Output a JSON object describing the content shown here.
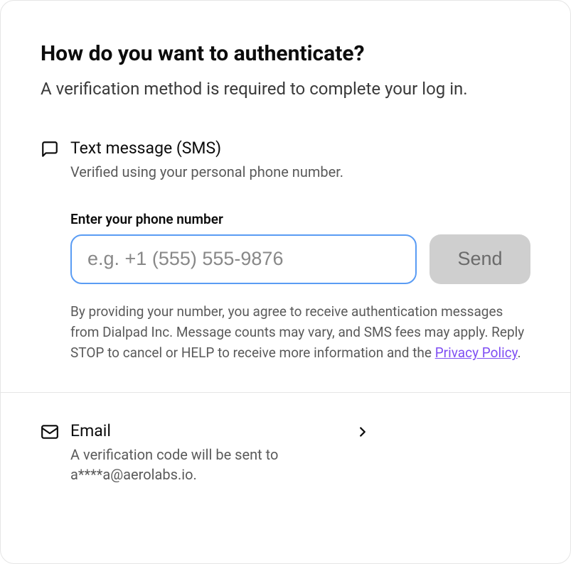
{
  "header": {
    "title": "How do you want to authenticate?",
    "subtitle": "A verification method is required to complete your log in."
  },
  "sms": {
    "title": "Text message (SMS)",
    "description": "Verified using your personal phone number.",
    "input_label": "Enter your phone number",
    "input_placeholder": "e.g. +1 (555) 555-9876",
    "input_value": "",
    "send_label": "Send",
    "disclaimer_prefix": "By providing your number, you agree to receive authentication messages from Dialpad Inc. Message counts may vary, and SMS fees may apply. Reply STOP to cancel or HELP to receive more information and the ",
    "privacy_link_text": "Privacy Policy",
    "disclaimer_suffix": "."
  },
  "email": {
    "title": "Email",
    "description": "A verification code will be sent to a****a@aerolabs.io."
  }
}
